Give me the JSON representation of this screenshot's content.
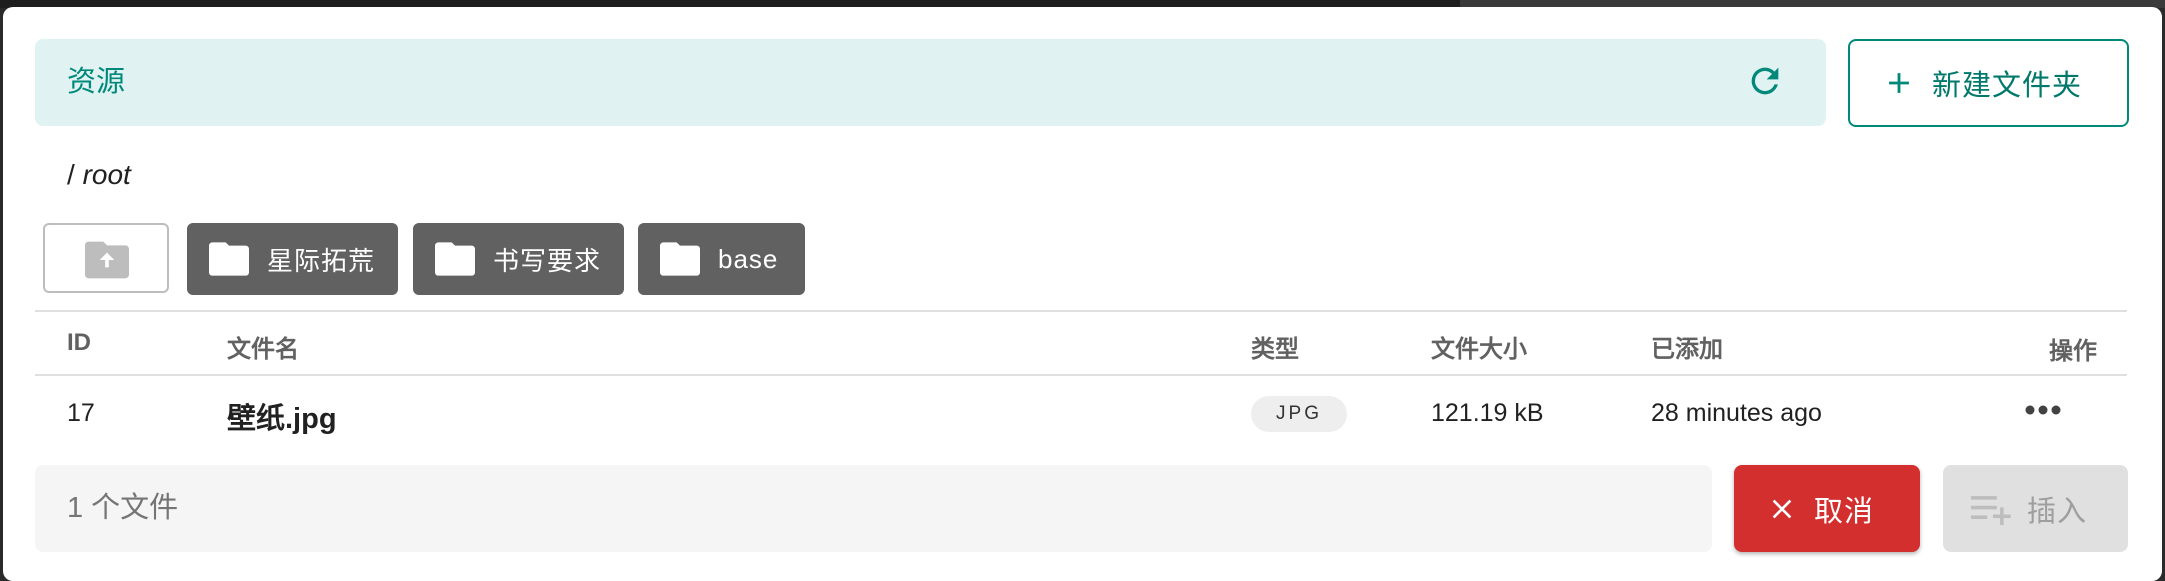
{
  "header": {
    "title": "资源",
    "refresh_icon": "refresh-icon",
    "new_folder_label": "新建文件夹"
  },
  "path": {
    "separator": "/",
    "current": "root"
  },
  "folders": [
    {
      "name": "星际拓荒"
    },
    {
      "name": "书写要求"
    },
    {
      "name": "base"
    }
  ],
  "table": {
    "columns": [
      "ID",
      "文件名",
      "类型",
      "文件大小",
      "已添加",
      "操作"
    ],
    "rows": [
      {
        "id": "17",
        "name": "壁纸.jpg",
        "type": "JPG",
        "size": "121.19 kB",
        "added": "28 minutes ago"
      }
    ]
  },
  "footer": {
    "file_count": "1 个文件",
    "cancel_label": "取消",
    "insert_label": "插入"
  },
  "colors": {
    "accent": "#00897b",
    "header_bg": "#e0f2f1",
    "folder_chip": "#616161",
    "cancel": "#d32f2f",
    "disabled": "#e0e0e0"
  }
}
